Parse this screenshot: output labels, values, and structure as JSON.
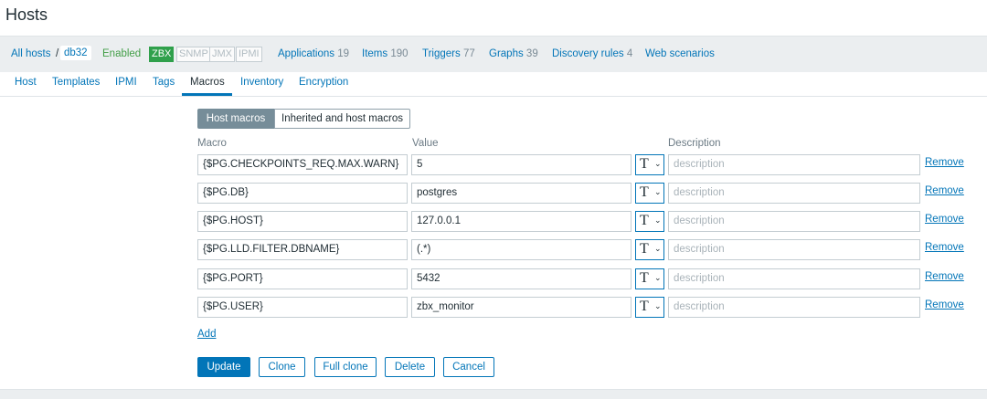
{
  "page": {
    "title": "Hosts"
  },
  "hostbar": {
    "all_hosts": "All hosts",
    "separator": "/",
    "host_name": "db32",
    "status": "Enabled",
    "availability": [
      "ZBX",
      "SNMP",
      "JMX",
      "IPMI"
    ],
    "links": [
      {
        "label": "Applications",
        "count": "19"
      },
      {
        "label": "Items",
        "count": "190"
      },
      {
        "label": "Triggers",
        "count": "77"
      },
      {
        "label": "Graphs",
        "count": "39"
      },
      {
        "label": "Discovery rules",
        "count": "4"
      },
      {
        "label": "Web scenarios",
        "count": ""
      }
    ]
  },
  "tabs": [
    "Host",
    "Templates",
    "IPMI",
    "Tags",
    "Macros",
    "Inventory",
    "Encryption"
  ],
  "active_tab": "Macros",
  "macro_toggle": {
    "host_macros": "Host macros",
    "inherited": "Inherited and host macros"
  },
  "columns": {
    "macro": "Macro",
    "value": "Value",
    "description": "Description"
  },
  "macros": [
    {
      "macro": "{$PG.CHECKPOINTS_REQ.MAX.WARN}",
      "value": "5",
      "type": "T",
      "description_placeholder": "description",
      "remove": "Remove"
    },
    {
      "macro": "{$PG.DB}",
      "value": "postgres",
      "type": "T",
      "description_placeholder": "description",
      "remove": "Remove"
    },
    {
      "macro": "{$PG.HOST}",
      "value": "127.0.0.1",
      "type": "T",
      "description_placeholder": "description",
      "remove": "Remove"
    },
    {
      "macro": "{$PG.LLD.FILTER.DBNAME}",
      "value": "(.*)",
      "type": "T",
      "description_placeholder": "description",
      "remove": "Remove"
    },
    {
      "macro": "{$PG.PORT}",
      "value": "5432",
      "type": "T",
      "description_placeholder": "description",
      "remove": "Remove"
    },
    {
      "macro": "{$PG.USER}",
      "value": "zbx_monitor",
      "type": "T",
      "description_placeholder": "description",
      "remove": "Remove"
    }
  ],
  "add_label": "Add",
  "buttons": {
    "update": "Update",
    "clone": "Clone",
    "full_clone": "Full clone",
    "delete": "Delete",
    "cancel": "Cancel"
  },
  "colors": {
    "accent": "#0275b8",
    "enabled": "#429e47",
    "zbx_badge": "#2fa04b",
    "toggle_active": "#768d99"
  }
}
